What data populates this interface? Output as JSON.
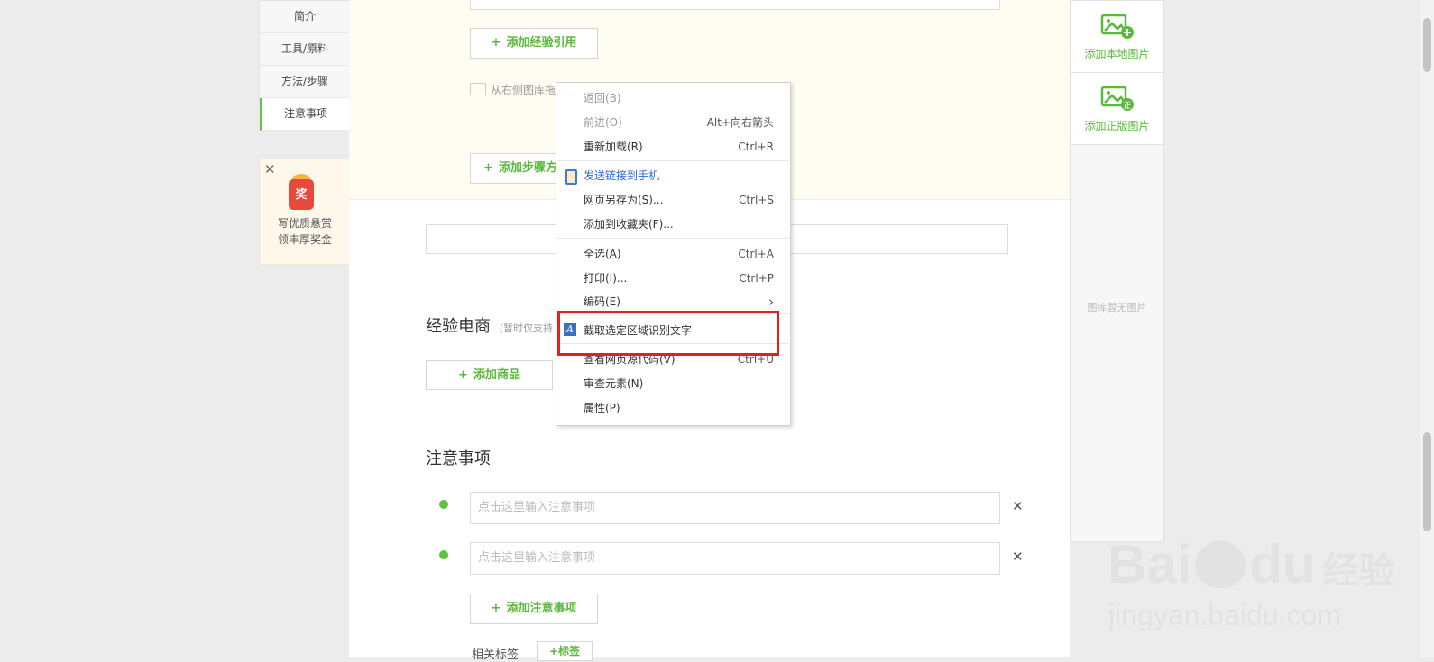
{
  "left_nav": {
    "items": [
      "简介",
      "工具/原料",
      "方法/步骤",
      "注意事项"
    ]
  },
  "reward": {
    "close": "✕",
    "badge": "奖",
    "line1": "写优质悬赏",
    "line2": "领丰厚奖金"
  },
  "editor": {
    "add_reference": "添加经验引用",
    "drag_hint": "从右侧图库拖",
    "add_step": "添加步骤方",
    "ecommerce_title": "经验电商",
    "ecommerce_note": "(暂时仅支持",
    "add_product": "添加商品",
    "notes_title": "注意事项",
    "note_placeholder": "点击这里输入注意事项",
    "add_note": "添加注意事项",
    "tags_label": "相关标签",
    "tags_button": "+标签",
    "plus": "+",
    "remove": "✕"
  },
  "right_panel": {
    "add_local": "添加本地图片",
    "add_licensed": "添加正版图片",
    "empty": "图库暂无图片"
  },
  "context_menu": {
    "items": [
      {
        "label": "返回(B)",
        "shortcut": ""
      },
      {
        "label": "前进(O)",
        "shortcut": "Alt+向右箭头"
      },
      {
        "label": "重新加载(R)",
        "shortcut": "Ctrl+R"
      },
      {
        "label": "发送链接到手机",
        "shortcut": ""
      },
      {
        "label": "网页另存为(S)...",
        "shortcut": "Ctrl+S"
      },
      {
        "label": "添加到收藏夹(F)...",
        "shortcut": ""
      },
      {
        "label": "全选(A)",
        "shortcut": "Ctrl+A"
      },
      {
        "label": "打印(I)...",
        "shortcut": "Ctrl+P"
      },
      {
        "label": "编码(E)",
        "shortcut": "›"
      },
      {
        "label": "截取选定区域识别文字",
        "shortcut": ""
      },
      {
        "label": "查看网页源代码(V)",
        "shortcut": "Ctrl+U"
      },
      {
        "label": "审查元素(N)",
        "shortcut": ""
      },
      {
        "label": "属性(P)",
        "shortcut": ""
      }
    ]
  },
  "watermark": {
    "brand": "Bai",
    "brand2": "du",
    "brand_cn": "经验",
    "url": "jingyan.baidu.com"
  },
  "colors": {
    "accent_green": "#5cb83d",
    "highlight_red": "#e32020"
  }
}
